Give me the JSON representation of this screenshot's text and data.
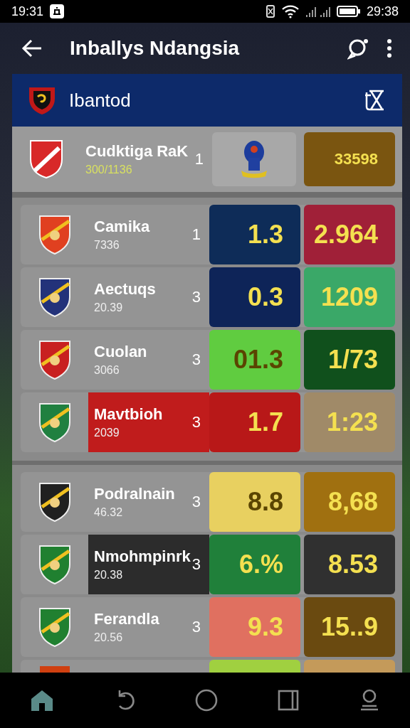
{
  "status_bar": {
    "time_left": "19:31",
    "time_right": "29:38"
  },
  "app_bar": {
    "title": "Inballys Ndangsia"
  },
  "league": {
    "title": "Ibantod",
    "crest": {
      "color": "#c01818"
    }
  },
  "featured": {
    "name": "Cudktiga RaK",
    "sub": "300/1136",
    "rank": "1",
    "value": "33598",
    "color": "#7a5510",
    "crest": {
      "color": "#d82828"
    }
  },
  "groups": [
    {
      "rows": [
        {
          "kind": "full",
          "name": "Camika",
          "sub": "7336",
          "rank": "1",
          "crest": {
            "color": "#e04020"
          },
          "cells": [
            {
              "value": "1.3",
              "color": "#0e2c58"
            },
            {
              "value": "2.964",
              "color": "#a02038"
            }
          ]
        },
        {
          "kind": "full",
          "name": "Aectuqs",
          "sub": "20.39",
          "rank": "3",
          "crest": {
            "color": "#23327a"
          },
          "cells": [
            {
              "value": "0.3",
              "color": "#0e2458"
            },
            {
              "value": "1209",
              "color": "#3aa868"
            }
          ]
        },
        {
          "kind": "full",
          "name": "Cuolan",
          "sub": "3066",
          "rank": "3",
          "crest": {
            "color": "#c82020"
          },
          "cells": [
            {
              "value": "01.3",
              "color": "#60cc40"
            },
            {
              "value": "1/73",
              "color": "#10501c"
            }
          ]
        },
        {
          "kind": "full",
          "name": "Mavtbioh",
          "sub": "2039",
          "rank": "3",
          "color": "#c01c1c",
          "crest": {
            "color": "#208040"
          },
          "cells": [
            {
              "value": "1.7",
              "color": "#b81818"
            },
            {
              "value": "1:23",
              "color": "#a08a68"
            }
          ]
        }
      ]
    },
    {
      "rows": [
        {
          "kind": "full",
          "name": "Podralnain",
          "sub": "46.32",
          "rank": "3",
          "crest": {
            "color": "#202020"
          },
          "cells": [
            {
              "value": "8.8",
              "color": "#e8d060"
            },
            {
              "value": "8,68",
              "color": "#a07010"
            }
          ]
        },
        {
          "kind": "full",
          "name": "Nmohmpinrk",
          "sub": "20.38",
          "rank": "3",
          "color": "#2c2c2c",
          "crest": {
            "color": "#208030"
          },
          "cells": [
            {
              "value": "6.%",
              "color": "#20803a"
            },
            {
              "value": "8.53",
              "color": "#303030"
            }
          ]
        },
        {
          "kind": "full",
          "name": "Ferandla",
          "sub": "20.56",
          "rank": "3",
          "crest": {
            "color": "#208030"
          },
          "cells": [
            {
              "value": "9.3",
              "color": "#e07060"
            },
            {
              "value": "15..9",
              "color": "#6a4a10"
            }
          ]
        },
        {
          "kind": "partial",
          "crest": {
            "color": "#d04010"
          },
          "cells": [
            {
              "color": "#a0d040"
            },
            {
              "color": "#c49a5a"
            }
          ]
        }
      ]
    }
  ],
  "nav": [
    {
      "kind": "home",
      "selected": true
    },
    {
      "kind": "back",
      "selected": false
    },
    {
      "kind": "circle",
      "selected": false
    },
    {
      "kind": "square",
      "selected": false
    },
    {
      "kind": "person",
      "selected": false
    }
  ]
}
